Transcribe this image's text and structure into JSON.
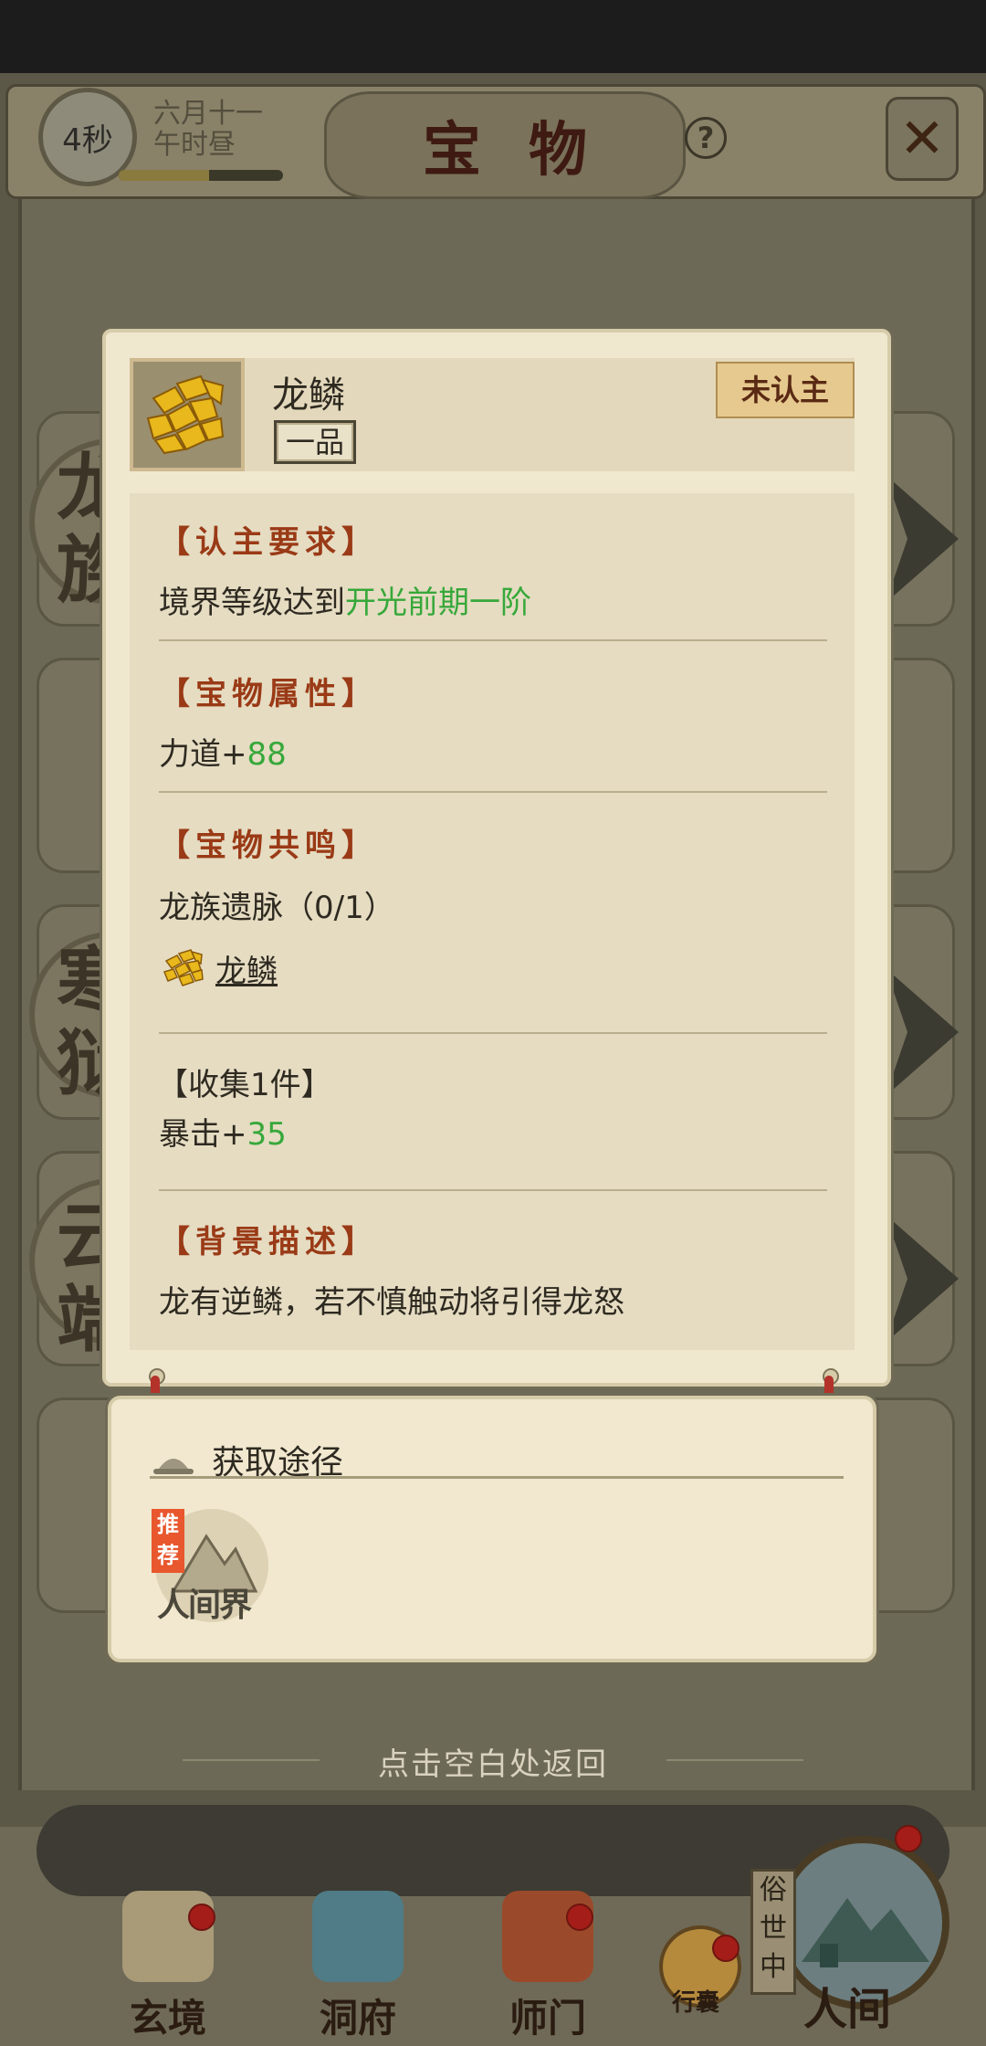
{
  "header": {
    "timer": "4秒",
    "date_line1": "六月十一",
    "date_line2": "午时昼",
    "title": "宝物",
    "help_icon": "question-icon",
    "close_icon": "close-x-icon",
    "timer_progress": 0.55
  },
  "item": {
    "name": "龙鳞",
    "quality": "一品",
    "status": "未认主",
    "icon": "dragon-scale-icon"
  },
  "sections": {
    "requirement": {
      "title": "【认主要求】",
      "prefix": "境界等级达到",
      "value": "开光前期一阶"
    },
    "attributes": {
      "title": "【宝物属性】",
      "stat": "力道+",
      "value": "88"
    },
    "resonance": {
      "title": "【宝物共鸣】",
      "set_name": "龙族遗脉（0/1）",
      "member": "龙鳞",
      "bonus_title": "【收集1件】",
      "bonus_stat": "暴击+",
      "bonus_value": "35"
    },
    "description": {
      "title": "【背景描述】",
      "text": "龙有逆鳞，若不慎触动将引得龙怒"
    }
  },
  "acquisition": {
    "title": "获取途径",
    "recommend": "推荐",
    "source": "人间界"
  },
  "hint": "点击空白处返回",
  "background_text": [
    "龙",
    "族",
    "寒",
    "狱",
    "云",
    "端"
  ],
  "nav": {
    "items": [
      {
        "label": "玄境",
        "icon": "scroll-icon"
      },
      {
        "label": "洞府",
        "icon": "pavilion-icon"
      },
      {
        "label": "师门",
        "icon": "banner-icon"
      },
      {
        "label": "行囊",
        "icon": "bag-icon"
      }
    ],
    "world_side": "俗世中",
    "world_label": "人间"
  },
  "colors": {
    "accent_red": "#9a3a16",
    "green_value": "#37a83a",
    "parchment": "#f0e7cf"
  }
}
